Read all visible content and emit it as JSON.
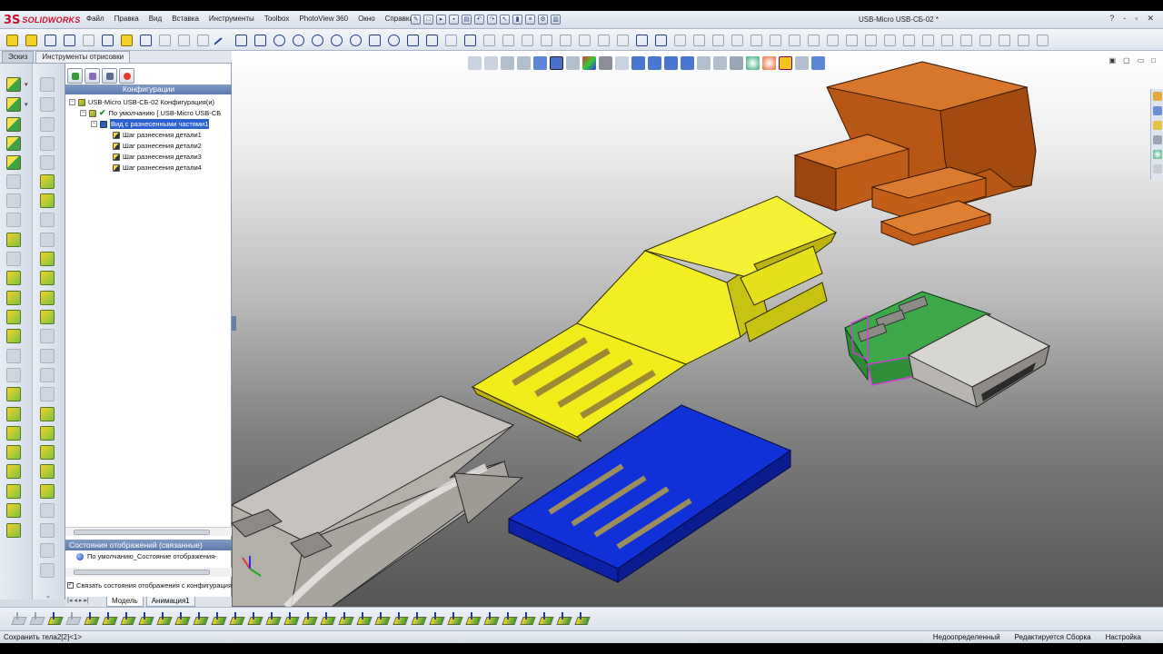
{
  "app": {
    "logo_mark": "3S",
    "logo_text": "SOLIDWORKS",
    "document_title": "USB-Micro USB-СБ-02 *"
  },
  "menu": {
    "items": [
      "Файл",
      "Правка",
      "Вид",
      "Вставка",
      "Инструменты",
      "Toolbox",
      "PhotoView 360",
      "Окно",
      "Справка"
    ]
  },
  "window_controls": [
    "?",
    "-",
    "▫",
    "✕"
  ],
  "command_tabs": [
    "Эскиз",
    "Инструменты отрисовки"
  ],
  "feature_manager": {
    "section_title": "Конфигурации",
    "tree": [
      {
        "label": "USB-Micro USB-СБ-02 Конфигурация(и)",
        "level": 0,
        "icon": "assembly-icon"
      },
      {
        "label": "По умолчанию [ USB-Micro USB-СБ",
        "level": 1,
        "icon": "active-config-icon"
      },
      {
        "label": "Вид с разнесенными частями1",
        "level": 2,
        "icon": "exploded-view-icon",
        "selected": true
      },
      {
        "label": "Шаг разнесения детали1",
        "level": 3,
        "icon": "explode-step-icon"
      },
      {
        "label": "Шаг разнесения детали2",
        "level": 3,
        "icon": "explode-step-icon"
      },
      {
        "label": "Шаг разнесения детали3",
        "level": 3,
        "icon": "explode-step-icon"
      },
      {
        "label": "Шаг разнесения детали4",
        "level": 3,
        "icon": "explode-step-icon"
      }
    ],
    "display_states_title": "Состояния отображений (связанные)",
    "display_state_item": "По умолчанию_Состояние отображения-",
    "link_checkbox_label": "Связать состояния отображения с конфигурация",
    "link_checked": true,
    "bottom_tabs": [
      "Модель",
      "Анимация1"
    ]
  },
  "statusbar": {
    "left": "Сохранить тела2[2]<1>",
    "items": [
      "Недоопределенный",
      "Редактируется Сборка",
      "Настройка"
    ]
  },
  "colors": {
    "part_orange": "#c7651c",
    "part_yellow": "#f1ea1c",
    "part_green": "#3fa548",
    "part_blue": "#1230d8",
    "contacts": "#a58f55",
    "shell_grey": "#b4b0aa",
    "selection_magenta": "#d23ad8"
  }
}
